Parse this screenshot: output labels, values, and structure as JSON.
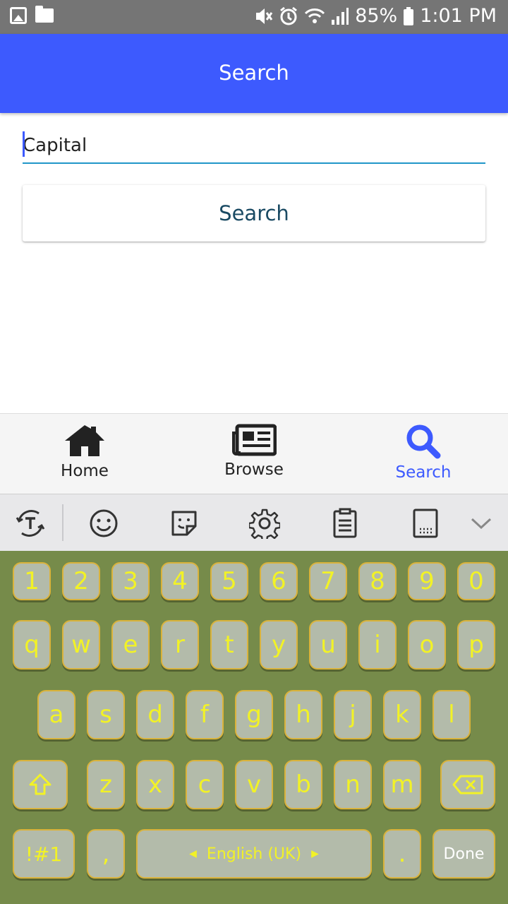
{
  "status_bar": {
    "battery": "85%",
    "time": "1:01 PM",
    "icons": [
      "image-icon",
      "folder-icon",
      "mute-icon",
      "alarm-icon",
      "wifi-icon",
      "signal-icon",
      "battery-icon"
    ]
  },
  "app_bar": {
    "title": "Search"
  },
  "search": {
    "input_value": "Capital",
    "button_label": "Search"
  },
  "tab_bar": {
    "tabs": [
      {
        "label": "Home",
        "icon": "home-icon"
      },
      {
        "label": "Browse",
        "icon": "newspaper-icon"
      },
      {
        "label": "Search",
        "icon": "search-icon",
        "active": true
      }
    ],
    "active_color": "#3d5afe"
  },
  "keyboard": {
    "toolbar_icons": [
      "translate-icon",
      "emoji-icon",
      "sticker-icon",
      "settings-icon",
      "clipboard-icon",
      "keyboard-size-icon",
      "chevron-down-icon"
    ],
    "row_numbers": [
      "1",
      "2",
      "3",
      "4",
      "5",
      "6",
      "7",
      "8",
      "9",
      "0"
    ],
    "row_1": [
      "q",
      "w",
      "e",
      "r",
      "t",
      "y",
      "u",
      "i",
      "o",
      "p"
    ],
    "row_2": [
      "a",
      "s",
      "d",
      "f",
      "g",
      "h",
      "j",
      "k",
      "l"
    ],
    "row_3": [
      "z",
      "x",
      "c",
      "v",
      "b",
      "n",
      "m"
    ],
    "symbols_label": "!#1",
    "comma_label": ",",
    "space_label": "English (UK)",
    "period_label": ".",
    "done_label": "Done",
    "colors": {
      "background": "#768b4a",
      "key": "#b3bbaa",
      "key_border": "#dab33b",
      "key_text": "#f2f226"
    }
  }
}
